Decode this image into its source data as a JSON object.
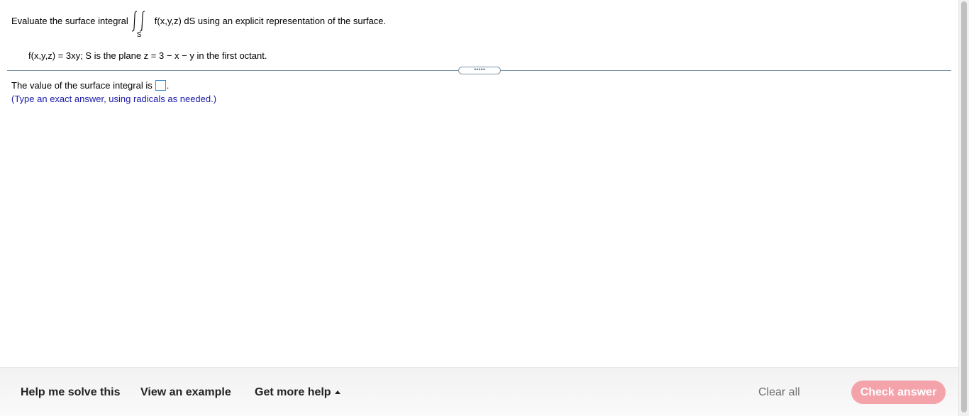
{
  "question": {
    "intro": "Evaluate the surface integral",
    "integral_subscript": "S",
    "integrand_text": "f(x,y,z) dS using an explicit representation of the surface."
  },
  "given": "f(x,y,z) = 3xy; S is the plane z = 3 − x − y in the first octant.",
  "divider_handle_label": "•••••",
  "answer": {
    "prompt": "The value of the surface integral is",
    "suffix": ".",
    "value": "",
    "hint": "(Type an exact answer, using radicals as needed.)"
  },
  "footer": {
    "help_me_solve": "Help me solve this",
    "view_example": "View an example",
    "get_more_help": "Get more help",
    "clear_all": "Clear all",
    "check_answer": "Check answer"
  },
  "colors": {
    "check_answer_bg": "#f4a3ab",
    "hint_text": "#1a1aa8",
    "answer_box_border": "#3f89c8",
    "divider": "#7a96a8"
  },
  "icons": {
    "double_integral": "double-integral-symbol",
    "more_help_caret": "caret-up-icon"
  }
}
